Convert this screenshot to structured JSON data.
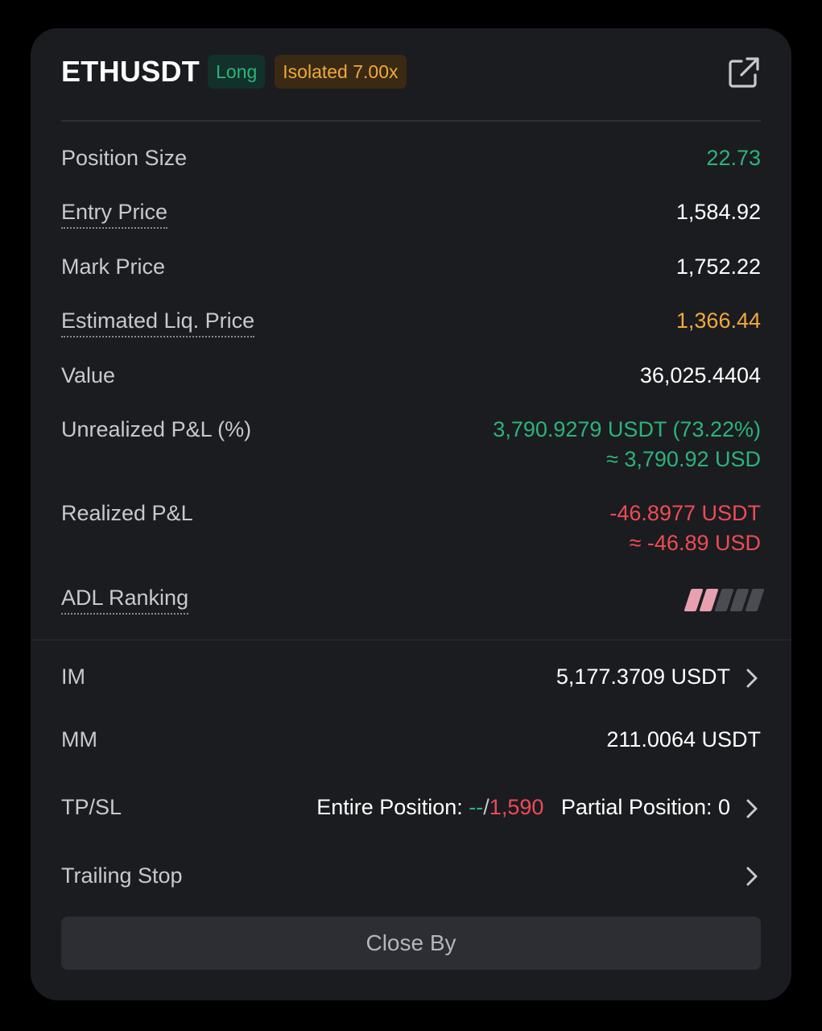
{
  "header": {
    "symbol": "ETHUSDT",
    "side_badge": "Long",
    "margin_badge": "Isolated 7.00x",
    "share_icon": "share-external-icon"
  },
  "details": [
    {
      "label": "Position Size",
      "value": "22.73",
      "color": "#2cb37a"
    },
    {
      "label": "Entry Price",
      "value": "1,584.92"
    },
    {
      "label": "Mark Price",
      "value": "1,752.22"
    },
    {
      "label": "Estimated Liq. Price",
      "value": "1,366.44",
      "color": "#f0a93b"
    },
    {
      "label": "Value",
      "value": "36,025.4404"
    },
    {
      "label": "Unrealized P&L (%)",
      "value": "3,790.9279 USDT (73.22%)",
      "sub_value": "≈ 3,790.92 USD",
      "color": "#2cb37a"
    },
    {
      "label": "Realized P&L",
      "value": "-46.8977 USDT",
      "sub_value": "≈ -46.89 USD",
      "color": "#ee4b55"
    },
    {
      "label": "ADL Ranking",
      "adl_level": 2,
      "adl_max": 5
    }
  ],
  "margin": {
    "im_label": "IM",
    "im_value": "5,177.3709 USDT",
    "mm_label": "MM",
    "mm_value": "211.0064 USDT",
    "tpsl_label": "TP/SL",
    "tpsl_entire_prefix": "Entire Position:",
    "tpsl_tp": "--",
    "tpsl_sep": "/",
    "tpsl_sl": "1,590",
    "tpsl_partial": "Partial Position: 0",
    "trailing_label": "Trailing Stop"
  },
  "close_button": "Close By"
}
